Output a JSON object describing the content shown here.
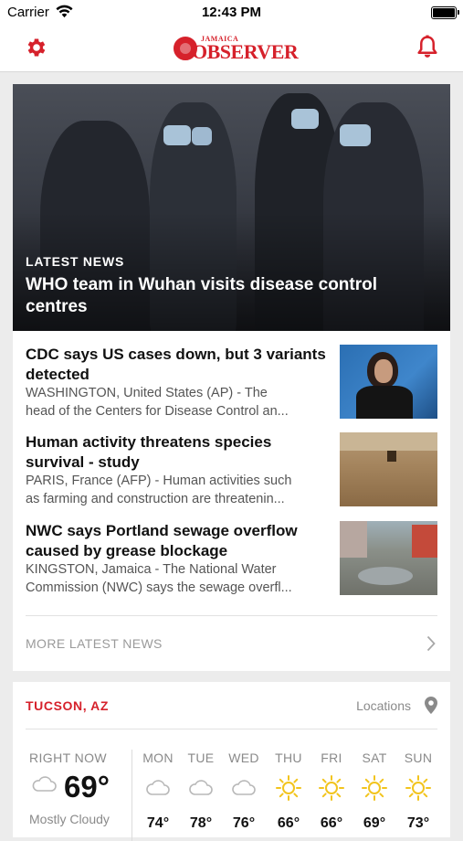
{
  "status_bar": {
    "carrier": "Carrier",
    "time": "12:43 PM"
  },
  "header": {
    "logo_small": "JAMAICA",
    "logo_main": "OBSERVER",
    "settings_icon": "gear-icon",
    "notifications_icon": "bell-icon",
    "accent_color": "#d6212b"
  },
  "hero": {
    "section_label": "LATEST NEWS",
    "title": "WHO team in Wuhan visits disease control centres"
  },
  "stories": [
    {
      "headline": "CDC says US cases down, but 3 variants detected",
      "summary_lines": [
        "WASHINGTON, United States (AP) - The",
        "head of the Centers for Disease Control an..."
      ]
    },
    {
      "headline": "Human activity threatens species survival - study",
      "summary_lines": [
        "PARIS, France (AFP) - Human activities such",
        "as farming and construction are threatenin..."
      ]
    },
    {
      "headline": "NWC says Portland sewage overflow caused by grease blockage",
      "summary_lines": [
        "KINGSTON, Jamaica - The National Water",
        "Commission (NWC) says the sewage overfl..."
      ]
    }
  ],
  "more_link": {
    "label": "MORE LATEST NEWS"
  },
  "weather": {
    "city": "TUCSON, AZ",
    "locations_label": "Locations",
    "now_label": "RIGHT NOW",
    "now_temp": "69°",
    "now_condition": "Mostly Cloudy",
    "days": [
      {
        "name": "MON",
        "icon": "cloud-icon",
        "high": "74°"
      },
      {
        "name": "TUE",
        "icon": "cloud-icon",
        "high": "78°"
      },
      {
        "name": "WED",
        "icon": "cloud-icon",
        "high": "76°"
      },
      {
        "name": "THU",
        "icon": "sun-icon",
        "high": "66°"
      },
      {
        "name": "FRI",
        "icon": "sun-icon",
        "high": "66°"
      },
      {
        "name": "SAT",
        "icon": "sun-icon",
        "high": "69°"
      },
      {
        "name": "SUN",
        "icon": "sun-icon",
        "high": "73°"
      }
    ]
  }
}
